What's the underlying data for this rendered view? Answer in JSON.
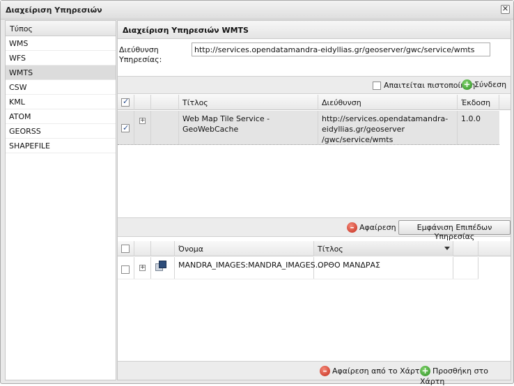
{
  "window": {
    "title": "Διαχείριση Υπηρεσιών",
    "close_glyph": "✕"
  },
  "types_panel": {
    "header": "Τύπος",
    "items": [
      {
        "label": "WMS",
        "selected": false
      },
      {
        "label": "WFS",
        "selected": false
      },
      {
        "label": "WMTS",
        "selected": true
      },
      {
        "label": "CSW",
        "selected": false
      },
      {
        "label": "KML",
        "selected": false
      },
      {
        "label": "ATOM",
        "selected": false
      },
      {
        "label": "GEORSS",
        "selected": false
      },
      {
        "label": "SHAPEFILE",
        "selected": false
      }
    ]
  },
  "service_panel": {
    "title": "Διαχείριση Υπηρεσιών WMTS",
    "url_label": "Διεύθυνση Υπηρεσίας:",
    "url_value": "http://services.opendatamandra-eidyllias.gr/geoserver/gwc/service/wmts",
    "auth_label": "Απαιτείται πιστοποίηση",
    "auth_checked": false,
    "connect_label": "Σύνδεση",
    "add_icon_glyph": "+",
    "remove_icon_glyph": "–",
    "services_grid": {
      "columns": [
        "Τίτλος",
        "Διεύθυνση",
        "Έκδοση"
      ],
      "header_checked": true,
      "rows": [
        {
          "checked": true,
          "expander": "+",
          "title": "Web Map Tile Service - GeoWebCache",
          "url_lines": [
            "http://services.opendatamandra-",
            "eidyllias.gr/geoserver",
            "/gwc/service/wmts"
          ],
          "version": "1.0.0"
        }
      ]
    },
    "remove_label": "Αφαίρεση",
    "show_layers_label": "Εμφάνιση Επιπέδων Υπηρεσίας",
    "layers_grid": {
      "columns": [
        "Όνομα",
        "Τίτλος"
      ],
      "header_checked": false,
      "rows": [
        {
          "checked": false,
          "expander": "+",
          "icon": "layer-icon",
          "name": "MANDRA_IMAGES:MANDRA_IMAGES…",
          "title": "ΟΡΘΟ ΜΑΝΔΡΑΣ"
        }
      ]
    },
    "remove_from_map_label": "Αφαίρεση από το Χάρτη",
    "add_to_map_label": "Προσθήκη στο Χάρτη"
  }
}
